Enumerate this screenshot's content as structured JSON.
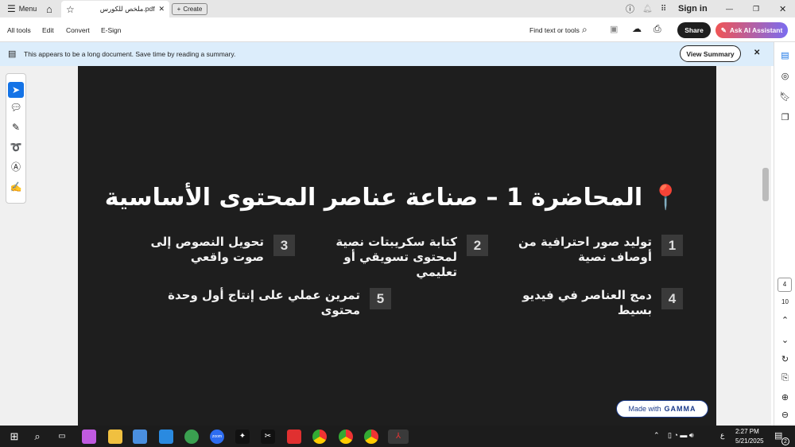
{
  "tabbar": {
    "menu": "Menu",
    "tab_title": "ملخص للكورس.pdf",
    "create": "Create",
    "sign_in": "Sign in"
  },
  "toolbar": {
    "items": [
      "All tools",
      "Edit",
      "Convert",
      "E-Sign"
    ],
    "find": "Find text or tools",
    "share": "Share",
    "ai": "Ask AI Assistant"
  },
  "banner": {
    "text": "This appears to be a long document. Save time by reading a summary.",
    "button": "View Summary"
  },
  "slide": {
    "title": "📍 المحاضرة 1 – صناعة عناصر المحتوى الأساسية",
    "items": [
      {
        "num": "1",
        "text": "توليد صور احترافية من أوصاف نصية"
      },
      {
        "num": "2",
        "text": "كتابة سكريبتات نصية لمحتوى تسويقي أو تعليمي"
      },
      {
        "num": "3",
        "text": "تحويل النصوص إلى صوت واقعي"
      },
      {
        "num": "4",
        "text": "دمج العناصر في فيديو بسيط"
      },
      {
        "num": "5",
        "text": "تمرين عملي على إنتاج أول وحدة محتوى"
      }
    ],
    "badge_prefix": "Made with",
    "badge_brand": "GAMMA"
  },
  "page_nav": {
    "current": "4",
    "total": "10"
  },
  "taskbar": {
    "time": "2:27 PM",
    "date": "5/21/2025",
    "lang": "ع",
    "notifications": "2"
  }
}
